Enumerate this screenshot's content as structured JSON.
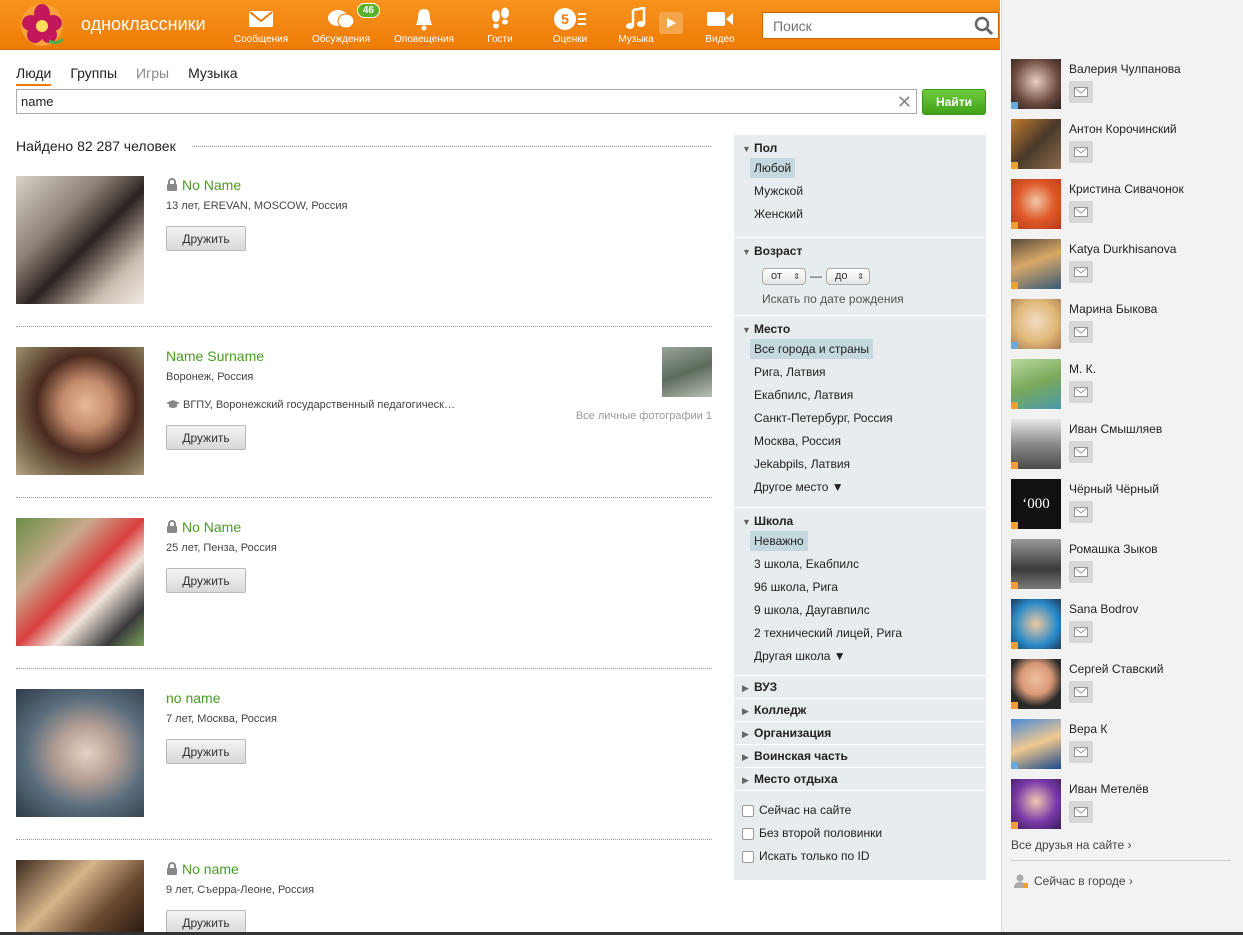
{
  "brand": "одноклассники",
  "nav": [
    {
      "icon": "envelope-icon",
      "label": "Сообщения"
    },
    {
      "icon": "chat-icon",
      "label": "Обсуждения",
      "badge": "46"
    },
    {
      "icon": "bell-icon",
      "label": "Оповещения"
    },
    {
      "icon": "footprints-icon",
      "label": "Гости"
    },
    {
      "icon": "rating-icon",
      "label": "Оценки",
      "badge_inline": "5"
    },
    {
      "icon": "music-icon",
      "label": "Музыка"
    },
    {
      "icon": "video-icon",
      "label": "Видео"
    }
  ],
  "search": {
    "placeholder": "Поиск"
  },
  "tabs": [
    {
      "label": "Люди",
      "active": true
    },
    {
      "label": "Группы"
    },
    {
      "label": "Игры",
      "disabled": true
    },
    {
      "label": "Музыка"
    }
  ],
  "query": {
    "value": "name",
    "button": "Найти"
  },
  "found_text": "Найдено 82 287 человек",
  "results": [
    {
      "name": "No Name",
      "locked": true,
      "info": "13 лет, EREVAN, MOSCOW, Россия",
      "button": "Дружить"
    },
    {
      "name": "Name Surname",
      "locked": false,
      "info": "Воронеж, Россия",
      "edu": "ВГПУ, Воронежский государственный педагогическ…",
      "photos_label": "Все личные фотографии 1",
      "button": "Дружить"
    },
    {
      "name": "No Name",
      "locked": true,
      "info": "25 лет, Пенза, Россия",
      "button": "Дружить"
    },
    {
      "name": "no name",
      "locked": false,
      "info": "7 лет, Москва, Россия",
      "button": "Дружить"
    },
    {
      "name": "No name",
      "locked": true,
      "info": "9 лет, Съерра-Леоне, Россия",
      "button": "Дружить"
    }
  ],
  "filters": {
    "gender": {
      "title": "Пол",
      "options": [
        "Любой",
        "Мужской",
        "Женский"
      ],
      "selected": "Любой"
    },
    "age": {
      "title": "Возраст",
      "from": "от",
      "to": "до",
      "dash": "—",
      "by_birthday": "Искать по дате рождения"
    },
    "place": {
      "title": "Место",
      "options": [
        "Все города и страны",
        "Рига, Латвия",
        "Екабпилс, Латвия",
        "Санкт-Петербург, Россия",
        "Москва, Россия",
        "Jekabpils, Латвия"
      ],
      "selected": "Все города и страны",
      "other": "Другое место ▼"
    },
    "school": {
      "title": "Школа",
      "options": [
        "Неважно",
        "3 школа, Екабпилс",
        "96 школа, Рига",
        "9 школа, Даугавпилс",
        "2 технический лицей, Рига"
      ],
      "selected": "Неважно",
      "other": "Другая школа ▼"
    },
    "collapsed": [
      "ВУЗ",
      "Колледж",
      "Организация",
      "Воинская часть",
      "Место отдыха"
    ],
    "checkboxes": [
      "Сейчас на сайте",
      "Без второй половинки",
      "Искать только по ID"
    ]
  },
  "friends": [
    {
      "name": "Валерия Чулпанова",
      "status": "blue"
    },
    {
      "name": "Антон Корочинский",
      "status": "orange"
    },
    {
      "name": "Кристина Сивачонок",
      "status": "orange"
    },
    {
      "name": "Katya Durkhisanova",
      "status": "orange"
    },
    {
      "name": "Марина Быкова",
      "status": "blue"
    },
    {
      "name": "М. К.",
      "status": "orange"
    },
    {
      "name": "Иван Смышляев",
      "status": "orange"
    },
    {
      "name": "Чёрный Чёрный",
      "status": "orange",
      "avatar_text": "‘000"
    },
    {
      "name": "Ромашка Зыков",
      "status": "orange"
    },
    {
      "name": "Sana Bodrov",
      "status": "orange"
    },
    {
      "name": "Сергей Ставский",
      "status": "orange"
    },
    {
      "name": "Вера К",
      "status": "blue"
    },
    {
      "name": "Иван Метелёв",
      "status": "orange"
    }
  ],
  "all_friends_link": "Все друзья на сайте ›",
  "in_city_link": "Сейчас в городе ›",
  "colors": {
    "brand_orange": "#ee7b05",
    "link_green": "#4a9b22",
    "button_green": "#3fa21a",
    "filter_bg": "#e7ecef"
  }
}
